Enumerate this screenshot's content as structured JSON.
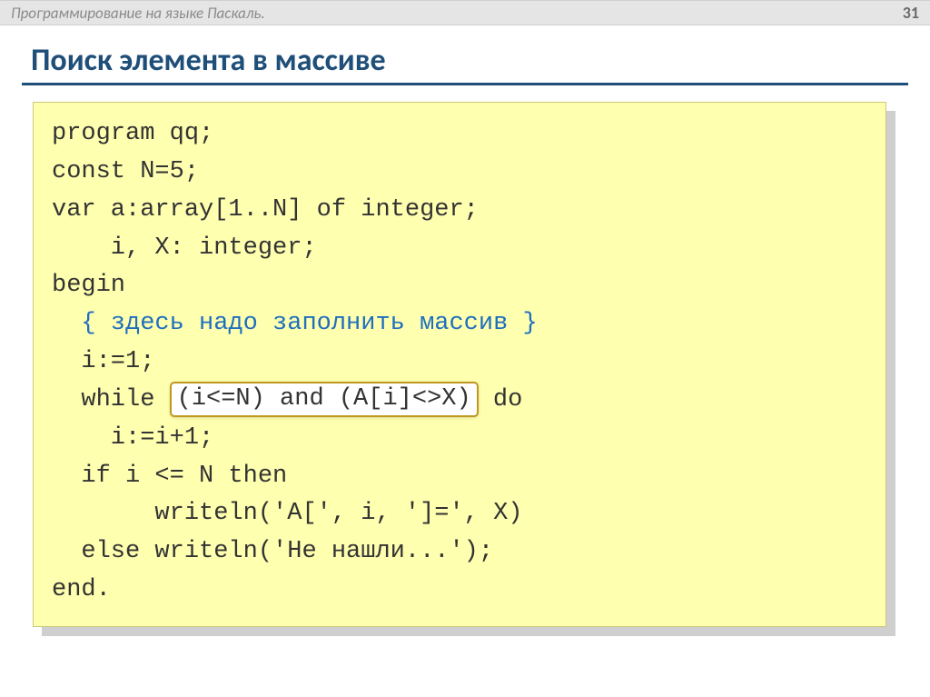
{
  "header": {
    "breadcrumb": "Программирование на языке Паскаль.",
    "page_number": "31"
  },
  "title": "Поиск элемента в массиве",
  "code": {
    "l1": "program qq;",
    "l2": "const N=5;",
    "l3": "var a:array[1..N] of integer;",
    "l4": "    i, X: integer;",
    "l5": "begin",
    "l6": "  { здесь надо заполнить массив }",
    "l7": "  i:=1;",
    "l8a": "  while ",
    "l8_box": "(i<=N) and (A[i]<>X)",
    "l8b": " do",
    "l9": "    i:=i+1;",
    "l10": "  if i <= N then",
    "l11": "       writeln('A[', i, ']=', X)",
    "l12": "  else writeln('Не нашли...');",
    "l13": "end."
  }
}
